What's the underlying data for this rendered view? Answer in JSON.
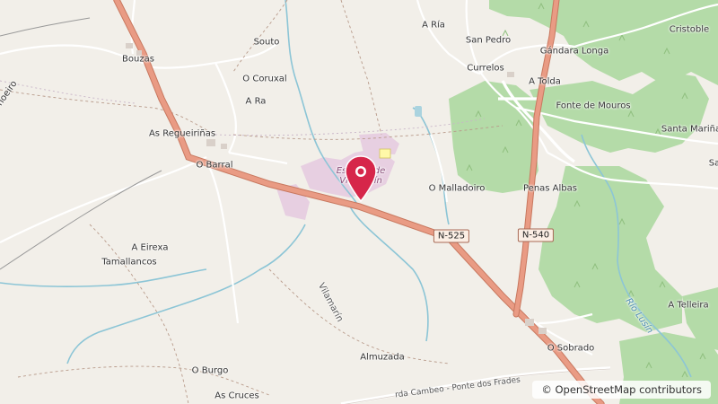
{
  "map": {
    "places": [
      {
        "id": "bouzas",
        "name": "Bouzas"
      },
      {
        "id": "souto",
        "name": "Souto"
      },
      {
        "id": "o-coruxal",
        "name": "O Coruxal"
      },
      {
        "id": "a-ra",
        "name": "A Ra"
      },
      {
        "id": "as-regueirinas",
        "name": "As Regueiriñas"
      },
      {
        "id": "o-barral",
        "name": "O Barral"
      },
      {
        "id": "a-eirexa",
        "name": "A Eirexa"
      },
      {
        "id": "tamallancos",
        "name": "Tamallancos"
      },
      {
        "id": "o-burgo",
        "name": "O Burgo"
      },
      {
        "id": "as-cruces",
        "name": "As Cruces"
      },
      {
        "id": "almuzada",
        "name": "Almuzada"
      },
      {
        "id": "o-malladoiro",
        "name": "O Malladoiro"
      },
      {
        "id": "a-ria",
        "name": "A Ría"
      },
      {
        "id": "san-pedro",
        "name": "San Pedro"
      },
      {
        "id": "gandara-longa",
        "name": "Gándara Longa"
      },
      {
        "id": "cristoble",
        "name": "Cristoble"
      },
      {
        "id": "currelos",
        "name": "Currelos"
      },
      {
        "id": "a-tolda",
        "name": "A Tolda"
      },
      {
        "id": "fonte-de-mouros",
        "name": "Fonte de Mouros"
      },
      {
        "id": "santa-marina",
        "name": "Santa Mariña"
      },
      {
        "id": "sa",
        "name": "Sa"
      },
      {
        "id": "penas-albas",
        "name": "Penas Albas"
      },
      {
        "id": "a-telleira",
        "name": "A Telleira"
      },
      {
        "id": "o-sobrado",
        "name": "O Sobrado"
      },
      {
        "id": "noeiro",
        "name": "noeiro"
      }
    ],
    "poi_label": "Escorial de Vilamarín",
    "roads": {
      "n525": "N-525",
      "n540": "N-540",
      "vilamarin": "Vilamarín",
      "cambeo": "rda Cambeo - Ponte dos Frades",
      "rio_lusin": "Río Lusín"
    },
    "marker": {
      "color": "#d6264a"
    }
  },
  "attribution": {
    "symbol": "©",
    "text": "OpenStreetMap contributors"
  },
  "colors": {
    "background": "#f2efe9",
    "forest": "#b4dba8",
    "forest_alt": "#a9cf98",
    "water": "#8cc5d6",
    "trunk_road": "#e99b84",
    "trunk_casing": "#c8785f",
    "industrial": "#e7cfe1"
  }
}
